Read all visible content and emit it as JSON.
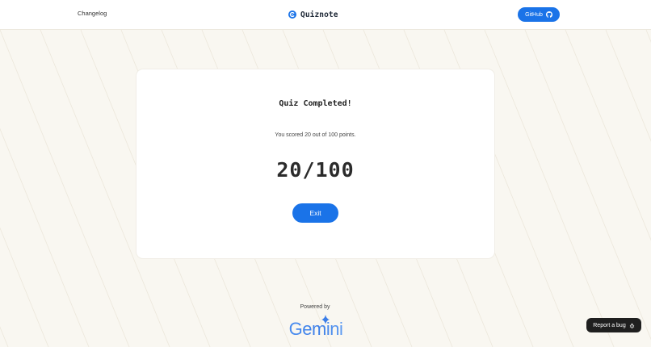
{
  "header": {
    "changelog_label": "Changelog",
    "brand_name": "Quiznote",
    "github_label": "GitHub"
  },
  "result": {
    "title": "Quiz Completed!",
    "message": "You scored 20 out of 100 points.",
    "score_display": "20/100",
    "score": 20,
    "max_score": 100,
    "exit_label": "Exit"
  },
  "footer": {
    "powered_by": "Powered by",
    "gemini_logo": "Gemini"
  },
  "report_bug_label": "Report a bug",
  "icons": {
    "brand": "quiznote-logo-icon",
    "github": "github-icon",
    "bug": "bug-icon",
    "gemini_spark": "gemini-sparkle-icon"
  },
  "colors": {
    "accent": "#1a73e8",
    "background": "#f9f7f1",
    "card": "#ffffff",
    "bug_button": "#1f1f1f"
  }
}
